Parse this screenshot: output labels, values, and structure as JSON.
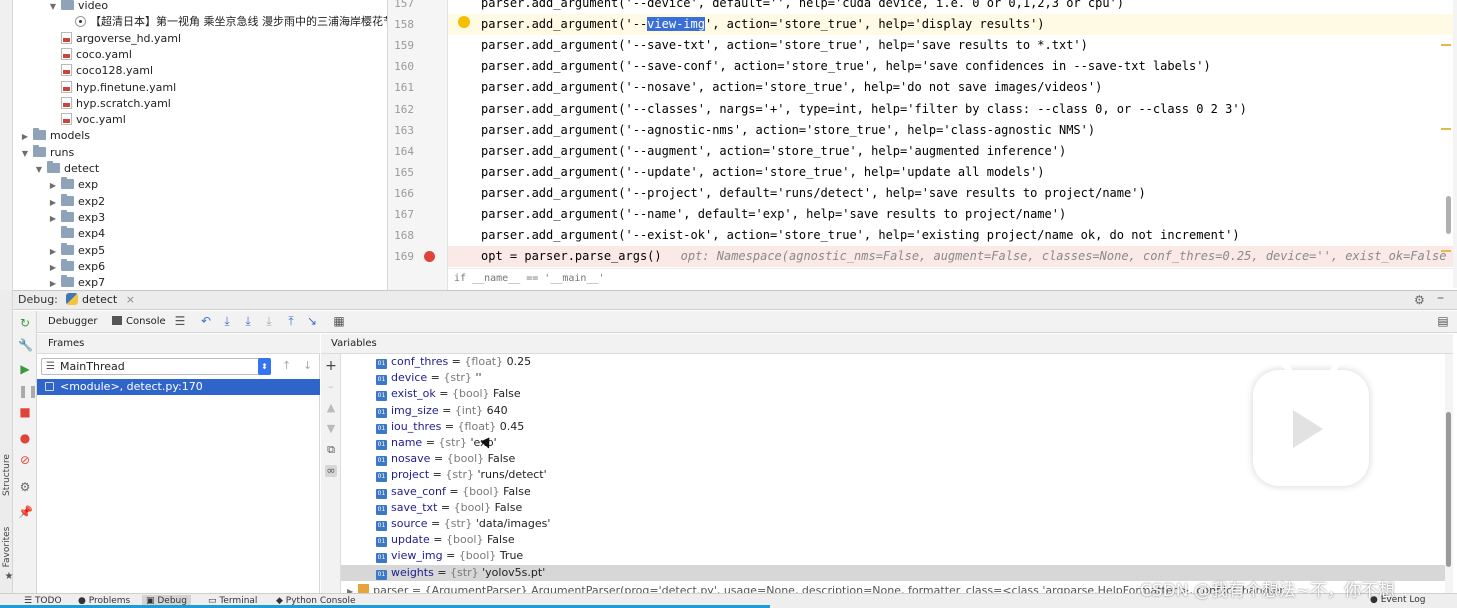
{
  "tree": {
    "items": [
      {
        "label": "video",
        "kind": "folder",
        "arrow": "▼",
        "indent": 3
      },
      {
        "label": "【超清日本】第一视角 乘坐京急线 漫步雨中的三浦海岸樱花节",
        "kind": "video",
        "arrow": "",
        "indent": 4
      },
      {
        "label": "argoverse_hd.yaml",
        "kind": "yml",
        "arrow": "",
        "indent": 3
      },
      {
        "label": "coco.yaml",
        "kind": "yml",
        "arrow": "",
        "indent": 3
      },
      {
        "label": "coco128.yaml",
        "kind": "yml",
        "arrow": "",
        "indent": 3
      },
      {
        "label": "hyp.finetune.yaml",
        "kind": "yml",
        "arrow": "",
        "indent": 3
      },
      {
        "label": "hyp.scratch.yaml",
        "kind": "yml",
        "arrow": "",
        "indent": 3
      },
      {
        "label": "voc.yaml",
        "kind": "yml",
        "arrow": "",
        "indent": 3
      },
      {
        "label": "models",
        "kind": "folder",
        "arrow": "▶",
        "indent": 1
      },
      {
        "label": "runs",
        "kind": "folder",
        "arrow": "▼",
        "indent": 1
      },
      {
        "label": "detect",
        "kind": "folder",
        "arrow": "▼",
        "indent": 2
      },
      {
        "label": "exp",
        "kind": "folder",
        "arrow": "▶",
        "indent": 3
      },
      {
        "label": "exp2",
        "kind": "folder",
        "arrow": "▶",
        "indent": 3
      },
      {
        "label": "exp3",
        "kind": "folder",
        "arrow": "▶",
        "indent": 3
      },
      {
        "label": "exp4",
        "kind": "folder",
        "arrow": "",
        "indent": 3
      },
      {
        "label": "exp5",
        "kind": "folder",
        "arrow": "▶",
        "indent": 3
      },
      {
        "label": "exp6",
        "kind": "folder",
        "arrow": "▶",
        "indent": 3
      },
      {
        "label": "exp7",
        "kind": "folder",
        "arrow": "▶",
        "indent": 3
      }
    ]
  },
  "editor": {
    "lines": [
      {
        "num": "157",
        "pre": "parser.add_argument('--device', default='', help='cuda device, i.e. 0 or 0,1,2,3 or cpu')",
        "hl": "",
        "post": "",
        "state": ""
      },
      {
        "num": "158",
        "pre": "parser.add_argument('--",
        "hl": "view-img",
        "post": "', action='store_true', help='display results')",
        "state": "cur"
      },
      {
        "num": "159",
        "pre": "parser.add_argument('--save-txt', action='store_true', help='save results to *.txt')",
        "hl": "",
        "post": "",
        "state": ""
      },
      {
        "num": "160",
        "pre": "parser.add_argument('--save-conf', action='store_true', help='save confidences in --save-txt labels')",
        "hl": "",
        "post": "",
        "state": ""
      },
      {
        "num": "161",
        "pre": "parser.add_argument('--nosave', action='store_true', help='do not save images/videos')",
        "hl": "",
        "post": "",
        "state": ""
      },
      {
        "num": "162",
        "pre": "parser.add_argument('--classes', nargs='+', type=int, help='filter by class: --class 0, or --class 0 2 3')",
        "hl": "",
        "post": "",
        "state": ""
      },
      {
        "num": "163",
        "pre": "parser.add_argument('--agnostic-nms', action='store_true', help='class-agnostic NMS')",
        "hl": "",
        "post": "",
        "state": ""
      },
      {
        "num": "164",
        "pre": "parser.add_argument('--augment', action='store_true', help='augmented inference')",
        "hl": "",
        "post": "",
        "state": ""
      },
      {
        "num": "165",
        "pre": "parser.add_argument('--update', action='store_true', help='update all models')",
        "hl": "",
        "post": "",
        "state": ""
      },
      {
        "num": "166",
        "pre": "parser.add_argument('--project', default='runs/detect', help='save results to project/name')",
        "hl": "",
        "post": "",
        "state": ""
      },
      {
        "num": "167",
        "pre": "parser.add_argument('--name', default='exp', help='save results to project/name')",
        "hl": "",
        "post": "",
        "state": ""
      },
      {
        "num": "168",
        "pre": "parser.add_argument('--exist-ok', action='store_true', help='existing project/name ok, do not increment')",
        "hl": "",
        "post": "",
        "state": ""
      },
      {
        "num": "169",
        "pre": "opt = parser.parse_args()",
        "hl": "",
        "post": "",
        "state": "bp",
        "inline": "opt: Namespace(agnostic_nms=False, augment=False, classes=None, conf_thres=0.25, device='', exist_ok=False"
      }
    ],
    "breadcrumb": "if __name__ == '__main__'"
  },
  "debug": {
    "label": "Debug:",
    "tab": "detect",
    "tab_close": "×",
    "debugger_tab": "Debugger",
    "console_tab": "Console",
    "frames_title": "Frames",
    "variables_title": "Variables",
    "thread": "MainThread",
    "frame": "<module>, detect.py:170"
  },
  "variables": [
    {
      "name": "conf_thres",
      "type": "{float}",
      "value": "0.25",
      "badge": "01"
    },
    {
      "name": "device",
      "type": "{str}",
      "value": "''",
      "badge": "01"
    },
    {
      "name": "exist_ok",
      "type": "{bool}",
      "value": "False",
      "badge": "01"
    },
    {
      "name": "img_size",
      "type": "{int}",
      "value": "640",
      "badge": "01"
    },
    {
      "name": "iou_thres",
      "type": "{float}",
      "value": "0.45",
      "badge": "01"
    },
    {
      "name": "name",
      "type": "{str}",
      "value": "'exp'",
      "badge": "01"
    },
    {
      "name": "nosave",
      "type": "{bool}",
      "value": "False",
      "badge": "01"
    },
    {
      "name": "project",
      "type": "{str}",
      "value": "'runs/detect'",
      "badge": "01"
    },
    {
      "name": "save_conf",
      "type": "{bool}",
      "value": "False",
      "badge": "01"
    },
    {
      "name": "save_txt",
      "type": "{bool}",
      "value": "False",
      "badge": "01"
    },
    {
      "name": "source",
      "type": "{str}",
      "value": "'data/images'",
      "badge": "01"
    },
    {
      "name": "update",
      "type": "{bool}",
      "value": "False",
      "badge": "01"
    },
    {
      "name": "view_img",
      "type": "{bool}",
      "value": "True",
      "badge": "01"
    },
    {
      "name": "weights",
      "type": "{str}",
      "value": "'yolov5s.pt'",
      "badge": "01"
    }
  ],
  "parser_row": "parser = {ArgumentParser} ArgumentParser(prog='detect.py', usage=None, description=None, formatter_class=<class 'argparse.HelpFormatter'>, conflict_handler",
  "side_labels": {
    "structure": "Structure",
    "favorites": "Favorites"
  },
  "bottom_tabs": {
    "todo": "TODO",
    "problems": "Problems",
    "debug": "Debug",
    "terminal": "Terminal",
    "python_console": "Python Console",
    "event_log": "Event Log"
  },
  "watermark": "CSDN @我有个想法~不，你不想",
  "colors": {
    "accent": "#3574f0",
    "selection": "#2f65ca",
    "breakpoint": "#e0433a",
    "progress": "#1e9bd8"
  }
}
